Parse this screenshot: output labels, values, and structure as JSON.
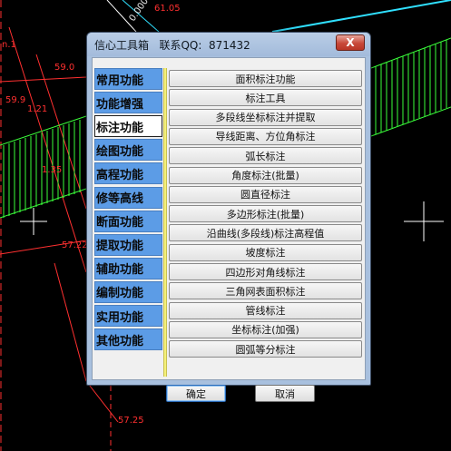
{
  "dialog": {
    "title": "信心工具箱   联系QQ:  871432",
    "close_label": "X",
    "ok_label": "确定",
    "cancel_label": "取消"
  },
  "categories": [
    {
      "label": "常用功能",
      "active": false
    },
    {
      "label": "功能增强",
      "active": false
    },
    {
      "label": "标注功能",
      "active": true
    },
    {
      "label": "绘图功能",
      "active": false
    },
    {
      "label": "高程功能",
      "active": false
    },
    {
      "label": "修等高线",
      "active": false
    },
    {
      "label": "断面功能",
      "active": false
    },
    {
      "label": "提取功能",
      "active": false
    },
    {
      "label": "辅助功能",
      "active": false
    },
    {
      "label": "编制功能",
      "active": false
    },
    {
      "label": "实用功能",
      "active": false
    },
    {
      "label": "其他功能",
      "active": false
    }
  ],
  "functions": [
    "面积标注功能",
    "标注工具",
    "多段线坐标标注并提取",
    "导线距离、方位角标注",
    "弧长标注",
    "角度标注(批量)",
    "圆直径标注",
    "多边形标注(批量)",
    "沿曲线(多段线)标注高程值",
    "坡度标注",
    "四边形对角线标注",
    "三角网表面积标注",
    "管线标注",
    "坐标标注(加强)",
    "圆弧等分标注"
  ],
  "cad_labels": {
    "top": "61.05",
    "left_top": "n.1",
    "l1": "59.0",
    "l2": "59.9",
    "l3": "1.21",
    "l4": "1.35",
    "l5": "57.22",
    "bottom": "57.25",
    "diag": "0.00000"
  },
  "colors": {
    "accent_blue": "#5c9ce6",
    "title_bar": "#a8c0de",
    "divider_yellow": "#f4f07a",
    "cad_red": "#ff3030",
    "cad_green": "#3aff3a",
    "cad_cyan": "#30e0ff"
  }
}
